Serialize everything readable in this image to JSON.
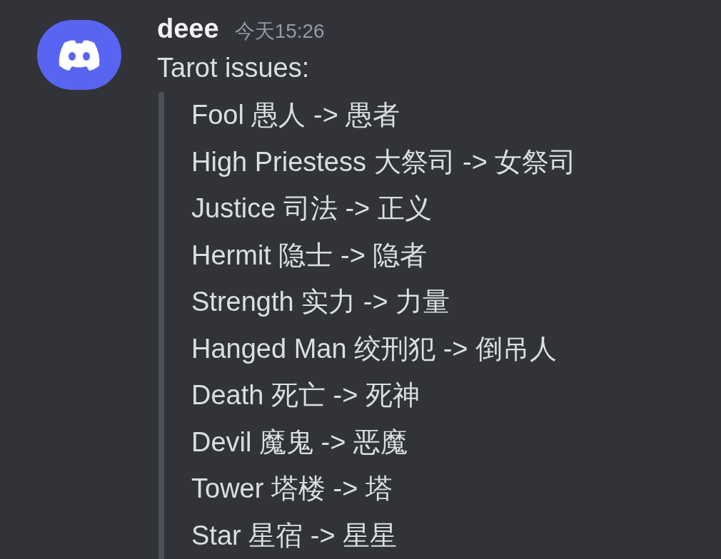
{
  "message": {
    "author": "deee",
    "timestamp": "今天15:26",
    "text": "Tarot issues:",
    "quote_lines": [
      "Fool 愚人 -> 愚者",
      "High Priestess 大祭司 -> 女祭司",
      "Justice 司法 -> 正义",
      "Hermit 隐士 -> 隐者",
      "Strength 实力 -> 力量",
      "Hanged Man 绞刑犯 -> 倒吊人",
      "Death 死亡 -> 死神",
      "Devil 魔鬼 -> 恶魔",
      "Tower 塔楼 -> 塔",
      "Star 星宿 -> 星星"
    ]
  }
}
